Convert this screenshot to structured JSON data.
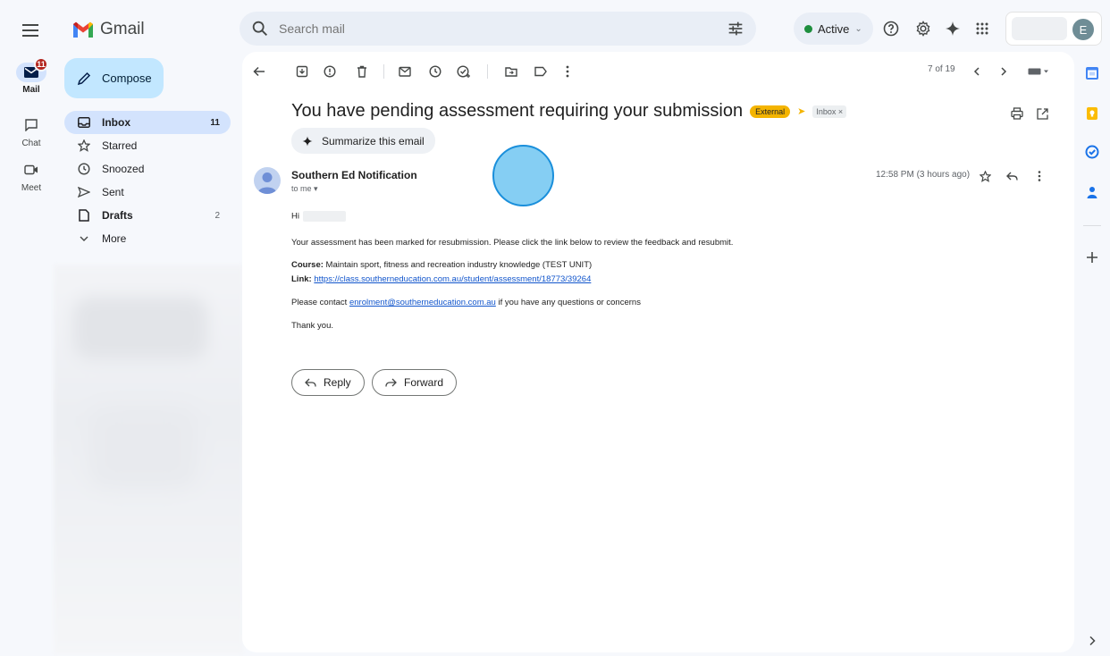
{
  "app": {
    "name": "Gmail"
  },
  "search": {
    "placeholder": "Search mail"
  },
  "status": {
    "label": "Active"
  },
  "account": {
    "initial": "E"
  },
  "rail": {
    "mail": {
      "label": "Mail",
      "badge": "11"
    },
    "chat": {
      "label": "Chat"
    },
    "meet": {
      "label": "Meet"
    }
  },
  "compose": {
    "label": "Compose"
  },
  "nav": [
    {
      "label": "Inbox",
      "count": "11",
      "icon": "inbox-icon"
    },
    {
      "label": "Starred",
      "count": "",
      "icon": "star-icon"
    },
    {
      "label": "Snoozed",
      "count": "",
      "icon": "clock-icon"
    },
    {
      "label": "Sent",
      "count": "",
      "icon": "send-icon"
    },
    {
      "label": "Drafts",
      "count": "2",
      "icon": "draft-icon"
    },
    {
      "label": "More",
      "count": "",
      "icon": "chevron-down-icon"
    }
  ],
  "toolbar": {
    "counter": "7 of 19"
  },
  "email": {
    "subject": "You have pending assessment requiring your submission",
    "tag_external": "External",
    "tag_inbox": "Inbox ×",
    "summarize": "Summarize this email",
    "sender": "Southern Ed Notification",
    "to": "to me",
    "time": "12:58 PM (3 hours ago)",
    "greeting": "Hi",
    "line1": "Your assessment has been marked for resubmission. Please click the link below to review the feedback and resubmit.",
    "course_label": "Course:",
    "course_value": "Maintain sport, fitness and recreation industry knowledge (TEST UNIT)",
    "link_label": "Link:",
    "link_url": "https://class.southerneducation.com.au/student/assessment/18773/39264",
    "contact_prefix": "Please contact",
    "contact_email": "enrolment@southerneducation.com.au",
    "contact_suffix": "if you have any questions or concerns",
    "signoff": "Thank you."
  },
  "actions": {
    "reply": "Reply",
    "forward": "Forward"
  },
  "colors": {
    "accent": "#c2e7ff",
    "selected_nav": "#d3e3fd",
    "badge": "#b3261e",
    "external_tag": "#f4b400",
    "link": "#1155cc"
  }
}
